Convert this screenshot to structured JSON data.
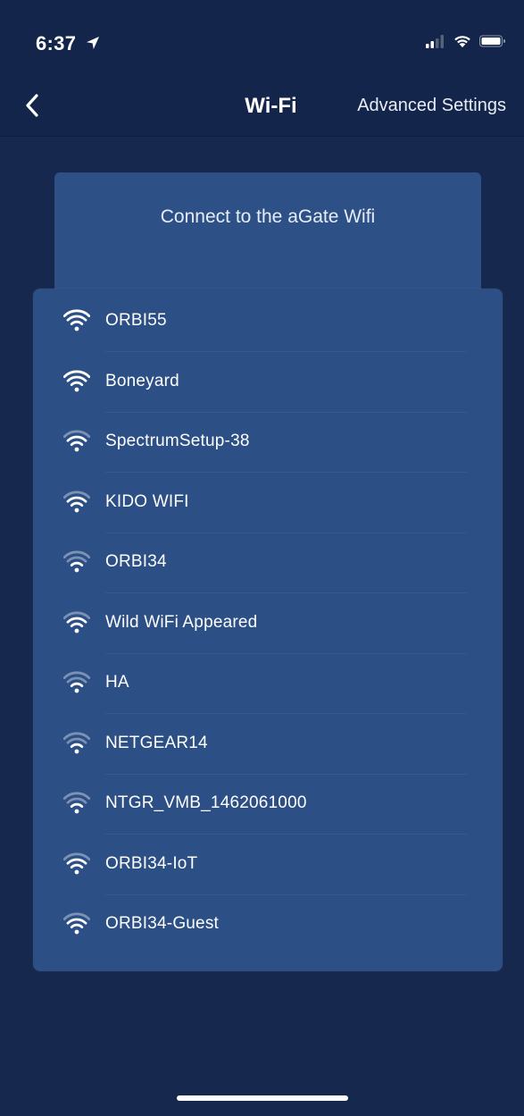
{
  "status_bar": {
    "time": "6:37"
  },
  "nav": {
    "title": "Wi-Fi",
    "advanced_label": "Advanced Settings"
  },
  "header_card": {
    "title": "Connect to the aGate Wifi"
  },
  "wifi_networks": [
    {
      "name": "ORBI55",
      "strength": "strong"
    },
    {
      "name": "Boneyard",
      "strength": "strong"
    },
    {
      "name": "SpectrumSetup-38",
      "strength": "medium"
    },
    {
      "name": "KIDO WIFI",
      "strength": "medium"
    },
    {
      "name": "ORBI34",
      "strength": "weak"
    },
    {
      "name": "Wild WiFi Appeared",
      "strength": "medium"
    },
    {
      "name": "HA",
      "strength": "weak"
    },
    {
      "name": "NETGEAR14",
      "strength": "weak"
    },
    {
      "name": "NTGR_VMB_1462061000",
      "strength": "weak"
    },
    {
      "name": "ORBI34-IoT",
      "strength": "medium"
    },
    {
      "name": "ORBI34-Guest",
      "strength": "medium"
    }
  ],
  "colors": {
    "background": "#16284d",
    "panel": "#2c4f86",
    "text": "#ffffff"
  },
  "icons": {
    "back": "chevron-left-icon",
    "location": "location-arrow-icon",
    "cellular": "cellular-signal-icon",
    "wifi_status": "wifi-icon",
    "battery": "battery-icon",
    "network": "wifi-icon"
  }
}
